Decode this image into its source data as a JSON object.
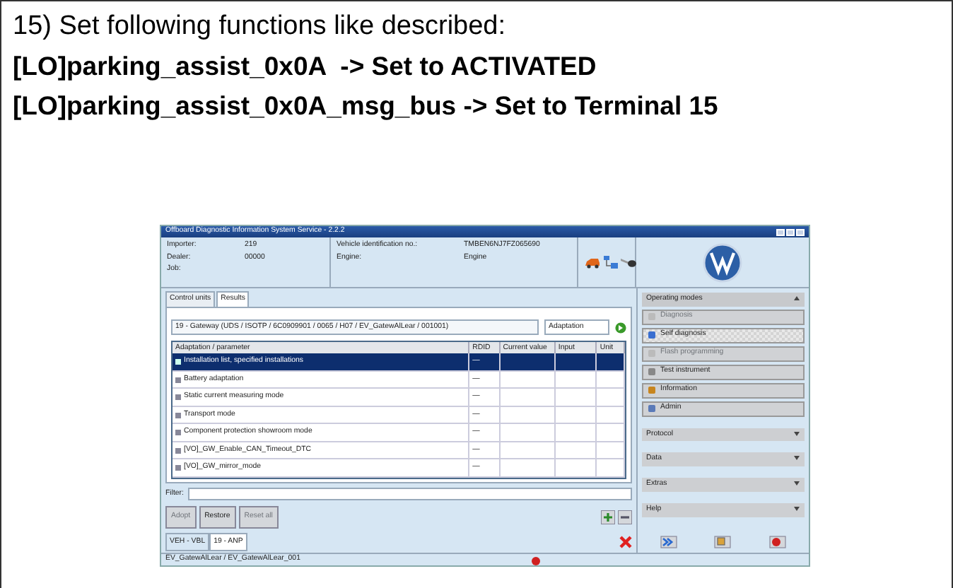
{
  "instruction": {
    "heading": "15) Set following functions like described:",
    "lines": [
      "[LO]parking_assist_0x0A  -> Set to ACTIVATED",
      "[LO]parking_assist_0x0A_msg_bus -> Set to Terminal 15"
    ]
  },
  "screenshot": {
    "title": "Offboard Diagnostic Information System Service - 2.2.2",
    "header": {
      "left_fields": [
        {
          "label": "Importer:",
          "value": "219"
        },
        {
          "label": "Dealer:",
          "value": "00000"
        },
        {
          "label": "Job:"
        }
      ],
      "right_fields": [
        {
          "label": "Vehicle identification no.:",
          "value": "TMBEN6NJ7FZ065690"
        },
        {
          "label": "Engine:",
          "value": "Engine"
        }
      ]
    },
    "tabs": [
      {
        "label": "Control units",
        "selected": false
      },
      {
        "label": "Results",
        "selected": true
      }
    ],
    "path": "19 - Gateway  (UDS / ISOTP / 6C0909901   / 0065 / H07 / EV_GatewAlLear / 001001)",
    "mode_select": "Adaptation",
    "table": {
      "columns": [
        "Adaptation / parameter",
        "RDID",
        "Current value",
        "Input",
        "Unit"
      ],
      "rows": [
        {
          "parameter": "Installation list, specified installations",
          "rdid": "—",
          "selected": true
        },
        {
          "parameter": "Battery adaptation",
          "rdid": "—",
          "selected": false
        },
        {
          "parameter": "Static current measuring mode",
          "rdid": "—",
          "selected": false
        },
        {
          "parameter": "Transport mode",
          "rdid": "—",
          "selected": false
        },
        {
          "parameter": "Component protection showroom mode",
          "rdid": "—",
          "selected": false
        },
        {
          "parameter": "[VO]_GW_Enable_CAN_Timeout_DTC",
          "rdid": "—",
          "selected": false
        },
        {
          "parameter": "[VO]_GW_mirror_mode",
          "rdid": "—",
          "selected": false
        }
      ]
    },
    "filter_label": "Filter:",
    "action_buttons": [
      {
        "label": "Adopt",
        "disabled": true
      },
      {
        "label": "Restore",
        "disabled": false
      },
      {
        "label": "Reset all",
        "disabled": true
      }
    ],
    "bottom_tabs": [
      {
        "label": "VEH - VBL",
        "selected": false
      },
      {
        "label": "19 - ANP",
        "selected": true
      }
    ],
    "status_bar": "EV_GatewAlLear / EV_GatewAlLear_001",
    "sidebar": {
      "title": "Operating modes",
      "modes": [
        {
          "label": "Diagnosis",
          "disabled": true,
          "selected": false
        },
        {
          "label": "Self diagnosis",
          "disabled": false,
          "selected": true
        },
        {
          "label": "Flash programming",
          "disabled": true,
          "selected": false
        },
        {
          "label": "Test instrument",
          "disabled": false,
          "selected": false
        },
        {
          "label": "Information",
          "disabled": false,
          "selected": false
        },
        {
          "label": "Admin",
          "disabled": false,
          "selected": false
        }
      ],
      "sections": [
        "Protocol",
        "Data",
        "Extras",
        "Help"
      ]
    }
  }
}
